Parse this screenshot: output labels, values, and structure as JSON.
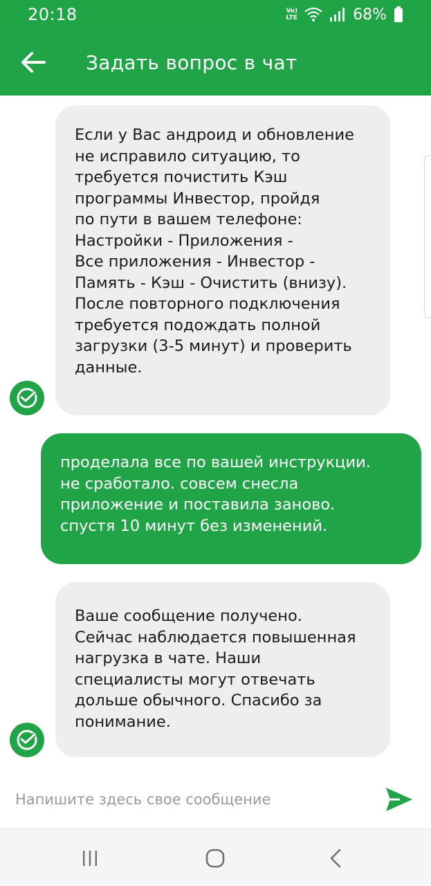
{
  "status_bar": {
    "time": "20:18",
    "network_label_top": "Vo)",
    "network_label_bottom": "LTE",
    "battery": "68%"
  },
  "app_bar": {
    "title": "Задать вопрос в чат",
    "back_icon": "arrow-left-icon"
  },
  "colors": {
    "brand_green": "#21a447",
    "incoming_bubble": "#eeeeee",
    "outgoing_text": "#ffffff"
  },
  "messages": [
    {
      "direction": "incoming",
      "text": "Если у Вас андроид и обновление\nне исправило ситуацию, то\nтребуется почистить Кэш\nпрограммы Инвестор, пройдя\nпо пути в вашем телефоне:\nНастройки - Приложения -\nВсе приложения - Инвестор -\nПамять - Кэш - Очистить (внизу).\nПосле повторного подключения\nтребуется подождать полной\nзагрузки (3-5 минут) и проверить\nданные."
    },
    {
      "direction": "outgoing",
      "text": "проделала все по вашей инструкции.\nне сработало. совсем снесла\nприложение и поставила заново.\nспустя 10 минут без изменений."
    },
    {
      "direction": "incoming",
      "text": "Ваше сообщение получено.\nСейчас наблюдается повышенная\nнагрузка в чате. Наши\nспециалисты могут отвечать\nдольше обычного. Спасибо за\nпонимание."
    }
  ],
  "input": {
    "placeholder": "Напишите здесь свое сообщение",
    "value": "",
    "send_icon": "send-icon"
  },
  "nav_bar": {
    "recent_icon": "recent-apps-icon",
    "home_icon": "home-icon",
    "back_icon": "back-chevron-icon"
  }
}
